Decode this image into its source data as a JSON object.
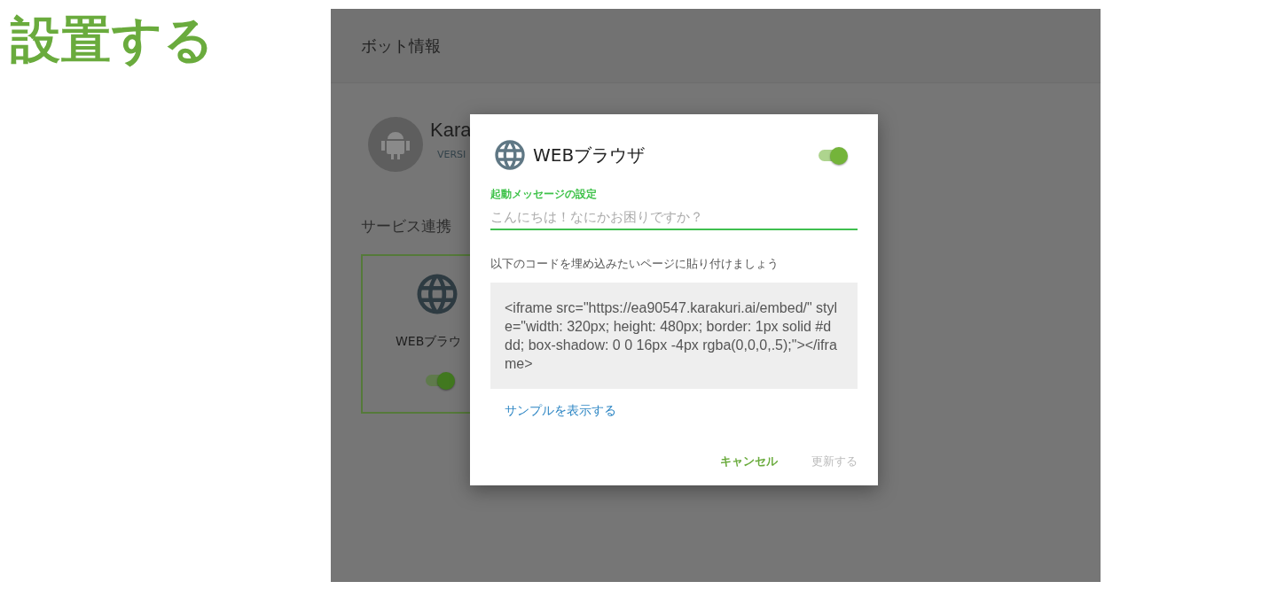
{
  "heading": "設置する",
  "app": {
    "header_title": "ボット情報",
    "bot": {
      "name": "Kara",
      "version": "VERSI"
    },
    "section_title": "サービス連携",
    "service_card": {
      "label": "WEBブラウ",
      "on": true,
      "selected": true
    }
  },
  "dialog": {
    "title": "WEBブラウザ",
    "on": true,
    "field": {
      "label": "起動メッセージの設定",
      "placeholder": "こんにちは！なにかお困りですか？"
    },
    "instruction": "以下のコードを埋め込みたいページに貼り付けましょう",
    "code": "<iframe src=\"https://ea90547.karakuri.ai/embed/\" style=\"width: 320px; height: 480px; border: 1px solid #ddd; box-shadow: 0 0 16px -4px rgba(0,0,0,.5);\"></iframe>",
    "sample_link": "サンプルを表示する",
    "buttons": [
      {
        "label": "キャンセル",
        "disabled": false
      },
      {
        "label": "更新する",
        "disabled": true
      }
    ]
  }
}
